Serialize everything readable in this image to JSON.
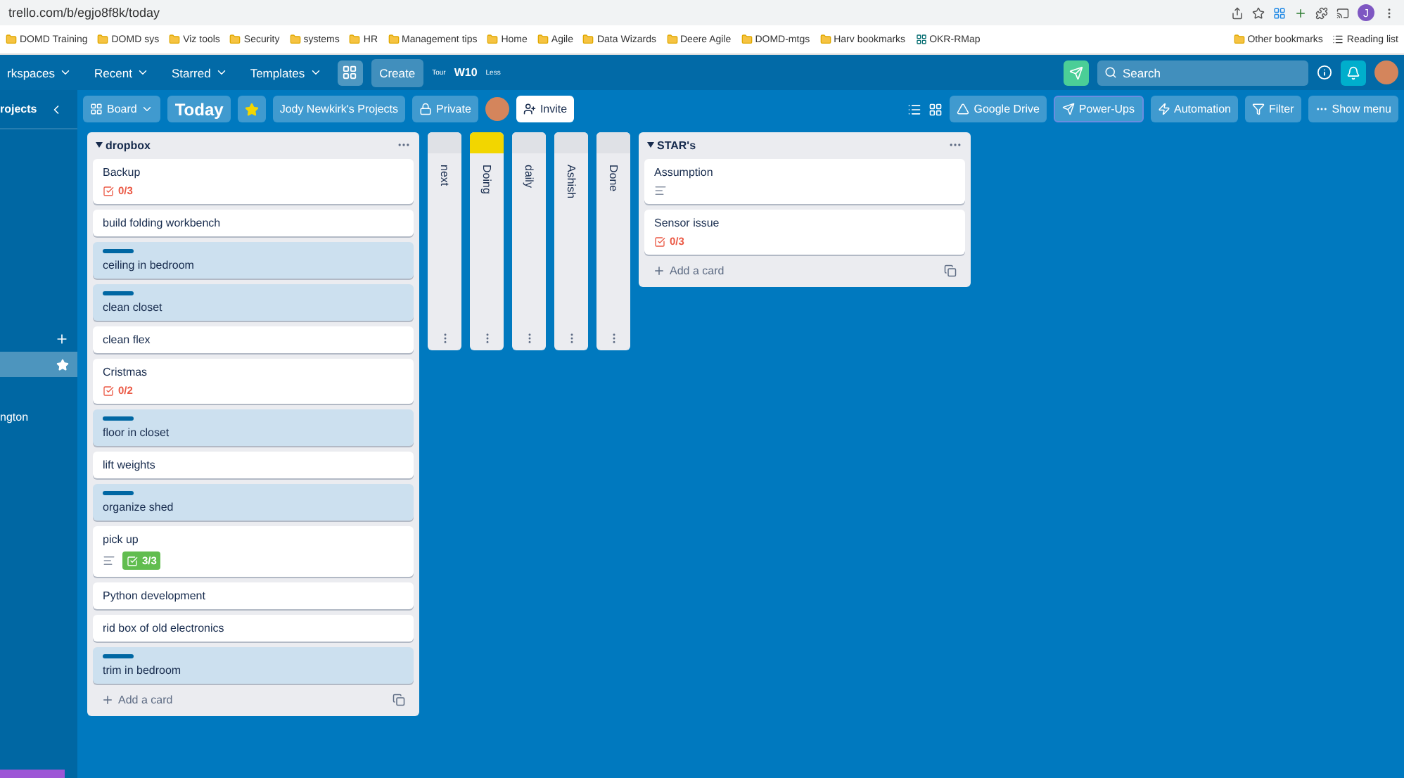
{
  "browser": {
    "url": "trello.com/b/egjo8f8k/today",
    "bookmarks": [
      {
        "label": "DOMD Training",
        "kind": "folder"
      },
      {
        "label": "DOMD sys",
        "kind": "folder"
      },
      {
        "label": "Viz tools",
        "kind": "folder"
      },
      {
        "label": "Security",
        "kind": "folder"
      },
      {
        "label": "systems",
        "kind": "folder"
      },
      {
        "label": "HR",
        "kind": "folder"
      },
      {
        "label": "Management tips",
        "kind": "folder"
      },
      {
        "label": "Home",
        "kind": "folder"
      },
      {
        "label": "Agile",
        "kind": "folder"
      },
      {
        "label": "Data Wizards",
        "kind": "folder"
      },
      {
        "label": "Deere Agile",
        "kind": "folder"
      },
      {
        "label": "DOMD-mtgs",
        "kind": "folder"
      },
      {
        "label": "Harv bookmarks",
        "kind": "folder"
      },
      {
        "label": "OKR-RMap",
        "kind": "site"
      }
    ],
    "other_bookmarks": "Other bookmarks",
    "reading_list": "Reading list",
    "profile_initial": "J"
  },
  "header": {
    "menus": [
      "rkspaces",
      "Recent",
      "Starred",
      "Templates"
    ],
    "create": "Create",
    "tour": "Tour",
    "ext_label": "W10",
    "less": "Less",
    "search_placeholder": "Search"
  },
  "board_bar": {
    "view": "Board",
    "title": "Today",
    "starred": true,
    "workspace": "Jody Newkirk's Projects",
    "visibility": "Private",
    "invite": "Invite",
    "actions": [
      "Google Drive",
      "Power-Ups",
      "Automation"
    ],
    "filter": "Filter",
    "show_menu": "Show menu"
  },
  "sidebar": {
    "title": "rojects",
    "items": [
      {
        "label": "ngton",
        "selected": false
      }
    ]
  },
  "lists": [
    {
      "kind": "open",
      "title": "dropbox",
      "cards": [
        {
          "title": "Backup",
          "labeled": false,
          "checklist": {
            "text": "0/3",
            "complete": false
          }
        },
        {
          "title": "build folding workbench",
          "labeled": false
        },
        {
          "title": "ceiling in bedroom",
          "labeled": true
        },
        {
          "title": "clean closet",
          "labeled": true
        },
        {
          "title": "clean flex",
          "labeled": false
        },
        {
          "title": "Cristmas",
          "labeled": false,
          "checklist": {
            "text": "0/2",
            "complete": false
          }
        },
        {
          "title": "floor in closet",
          "labeled": true
        },
        {
          "title": "lift weights",
          "labeled": false
        },
        {
          "title": "organize shed",
          "labeled": true
        },
        {
          "title": "pick up",
          "labeled": false,
          "description": true,
          "checklist": {
            "text": "3/3",
            "complete": true
          }
        },
        {
          "title": "Python development",
          "labeled": false
        },
        {
          "title": "rid box of old electronics",
          "labeled": false
        },
        {
          "title": "trim in bedroom",
          "labeled": true
        }
      ],
      "add": "Add a card"
    },
    {
      "kind": "collapsed",
      "title": "next"
    },
    {
      "kind": "collapsed",
      "title": "Doing",
      "color": "#f2d600"
    },
    {
      "kind": "collapsed",
      "title": "daily"
    },
    {
      "kind": "collapsed",
      "title": "Ashish"
    },
    {
      "kind": "collapsed",
      "title": "Done"
    },
    {
      "kind": "open",
      "title": "STAR's",
      "cards": [
        {
          "title": "Assumption",
          "labeled": false,
          "description": true
        },
        {
          "title": "Sensor issue",
          "labeled": false,
          "checklist": {
            "text": "0/3",
            "complete": false
          }
        }
      ],
      "add": "Add a card"
    }
  ]
}
